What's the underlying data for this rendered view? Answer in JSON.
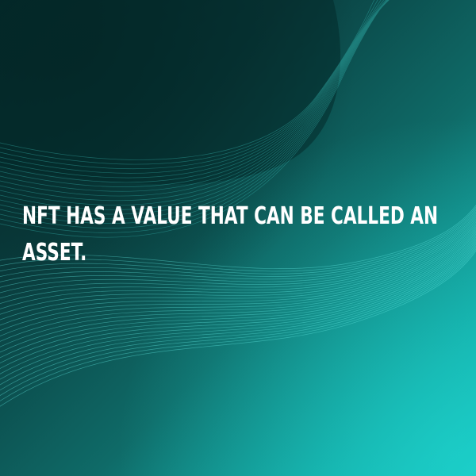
{
  "headline": {
    "text": "NFT HAS A VALUE THAT CAN BE CALLED AN ASSET."
  },
  "colors": {
    "background_dark": "#052a2c",
    "background_mid": "#0f6b68",
    "background_light": "#18c7c2",
    "text": "#ffffff"
  }
}
